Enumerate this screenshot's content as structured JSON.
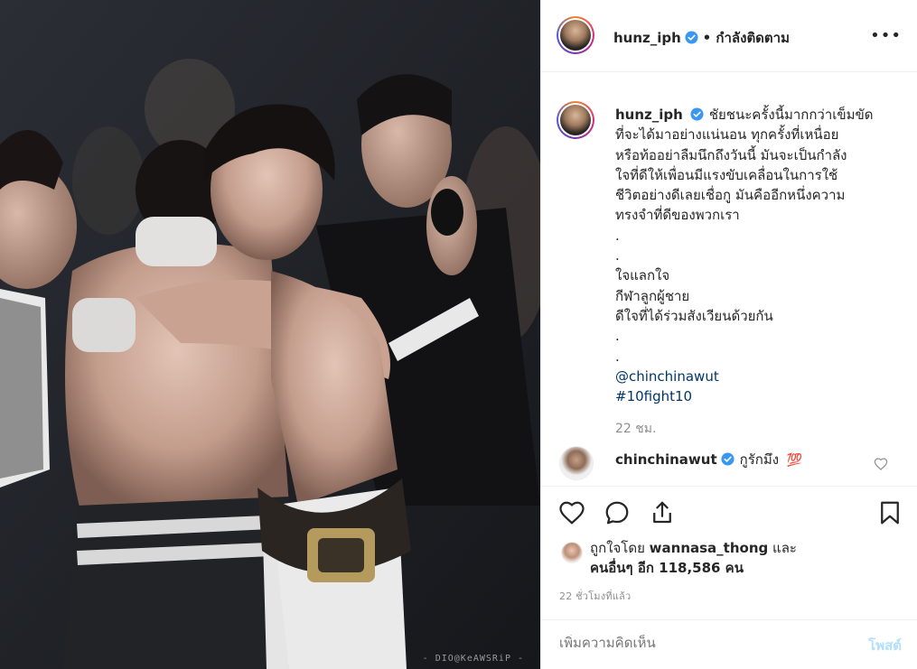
{
  "post": {
    "username": "hunz_iph",
    "follow_state": "• กำลังติดตาม",
    "more_label": "•••",
    "caption_lines": [
      "ชัยชนะครั้งนี้มากกว่าเข็มขัด",
      "ที่จะได้มาอย่างแน่นอน ทุกครั้งที่เหนื่อย",
      "หรือท้ออย่าลืมนึกถึงวันนี้ มันจะเป็นกำลัง",
      "ใจที่ดีให้เพื่อนมีแรงขับเคลื่อนในการใช้",
      "ชีวิตอย่างดีเลยเชื่อกู มันคืออีกหนึ่งความ",
      "ทรงจำที่ดีของพวกเรา",
      ".",
      ".",
      "ใจแลกใจ",
      "กีฬาลูกผู้ชาย",
      "ดีใจที่ได้ร่วมสังเวียนด้วยกัน",
      ".",
      "."
    ],
    "mention": "@chinchinawut",
    "hashtag": "#10fight10",
    "caption_time": "22 ชม.",
    "reply": {
      "username": "chinchinawut",
      "text": "กูรักมึง",
      "emoji": "💯"
    },
    "likes": {
      "prefix": "ถูกใจโดย",
      "liker": "wannasa_thong",
      "and": "และ",
      "others": "คนอื่นๆ อีก 118,586 คน"
    },
    "post_time": "22 ชั่วโมงที่แล้ว",
    "comment_placeholder": "เพิ่มความคิดเห็น",
    "post_button": "โพสต์"
  },
  "photo": {
    "watermark": "- DIO@KeAWSRiP -"
  },
  "icons": {
    "verified": "verified-badge-icon",
    "heart": "heart-icon",
    "comment": "comment-icon",
    "share": "share-icon",
    "bookmark": "bookmark-icon",
    "more": "more-options-icon"
  },
  "colors": {
    "verified": "#3897f0",
    "link": "#00376b",
    "post_button": "#b2dffc",
    "muted": "#8e8e8e",
    "text": "#262626"
  }
}
